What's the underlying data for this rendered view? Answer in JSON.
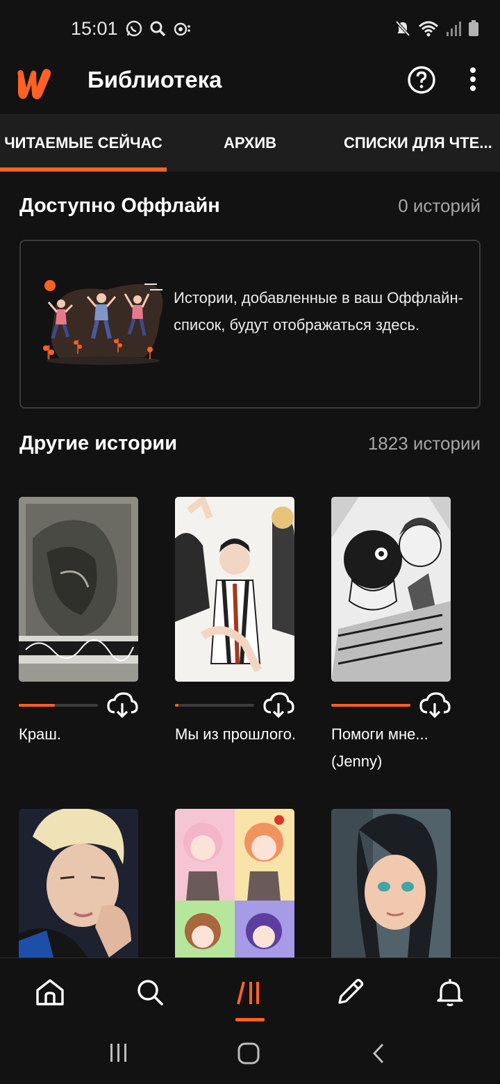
{
  "status_bar": {
    "time": "15:01"
  },
  "app_bar": {
    "title": "Библиотека"
  },
  "tabs": [
    {
      "label": "ЧИТАЕМЫЕ СЕЙЧАС",
      "active": true
    },
    {
      "label": "АРХИВ",
      "active": false
    },
    {
      "label": "СПИСКИ ДЛЯ ЧТЕ...",
      "active": false
    }
  ],
  "offline": {
    "title": "Доступно Оффлайн",
    "count": "0 историй",
    "empty_text": "Истории, добавленные в ваш Оффлайн-список, будут отображаться здесь."
  },
  "other": {
    "title": "Другие истории",
    "count": "1823 истории"
  },
  "stories": [
    {
      "title": "Краш.",
      "progress": 0.46
    },
    {
      "title": "Мы из прошлого.",
      "progress": 0.04
    },
    {
      "title": "Помоги мне... (Jenny)",
      "progress": 1.0
    }
  ],
  "colors": {
    "accent": "#ff6122",
    "background": "#121212",
    "tab_background": "#1e1e1e",
    "muted_text": "#a6a6a6"
  },
  "bottom_nav": [
    {
      "icon": "home-icon"
    },
    {
      "icon": "search-icon"
    },
    {
      "icon": "library-icon",
      "active": true
    },
    {
      "icon": "pencil-icon"
    },
    {
      "icon": "bell-icon"
    }
  ]
}
